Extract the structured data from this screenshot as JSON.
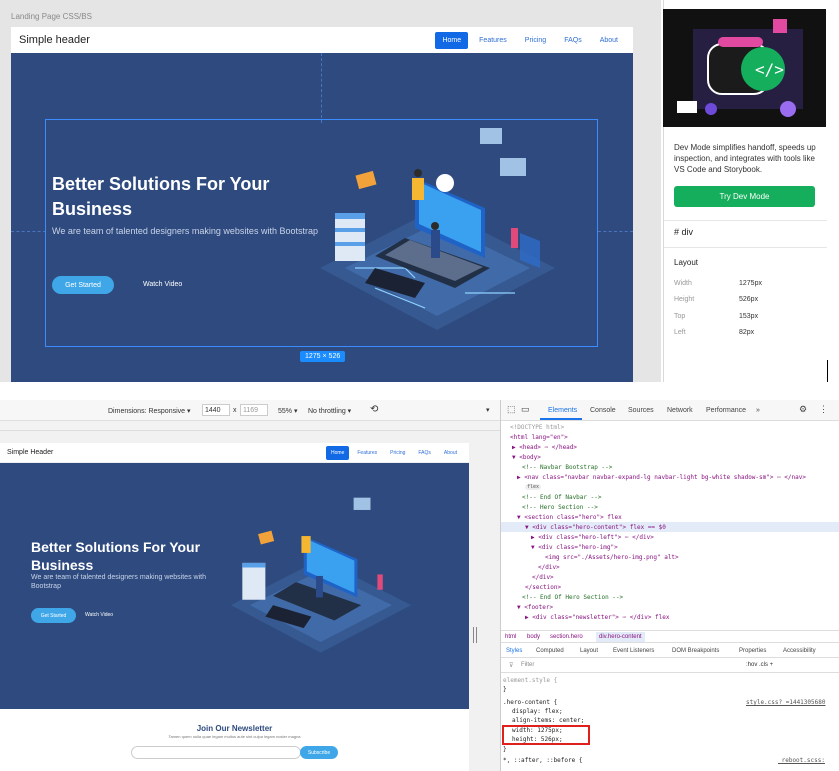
{
  "frame": {
    "label": "Landing Page CSS/BS",
    "size_badge": "1275 × 526",
    "nav": {
      "brand": "Simple header",
      "links": [
        "Home",
        "Features",
        "Pricing",
        "FAQs",
        "About"
      ]
    },
    "hero": {
      "title": "Better Solutions For Your Business",
      "subtitle": "We are team of talented designers making websites with Bootstrap",
      "cta": "Get Started",
      "watch": "Watch Video"
    }
  },
  "dev_panel": {
    "description": "Dev Mode simplifies handoff, speeds up inspection, and integrates with tools like VS Code and Storybook.",
    "try_button": "Try Dev Mode",
    "element_type": "div",
    "layout_heading": "Layout",
    "layout": [
      {
        "label": "Width",
        "value": "1275px"
      },
      {
        "label": "Height",
        "value": "526px"
      },
      {
        "label": "Top",
        "value": "153px"
      },
      {
        "label": "Left",
        "value": "82px"
      }
    ]
  },
  "devtools": {
    "toolbar": {
      "dimensions": "Dimensions: Responsive ▾",
      "width": "1440",
      "x": "x",
      "height": "1169",
      "zoom": "55% ▾",
      "throttle": "No throttling ▾"
    },
    "page": {
      "brand": "Simple Header",
      "links": [
        "Home",
        "Features",
        "Pricing",
        "FAQs",
        "About"
      ],
      "title": "Better Solutions For Your Business",
      "subtitle": "We are team of talented designers making websites with Bootstrap",
      "cta": "Get Started",
      "watch": "Watch Video",
      "newsletter_title": "Join Our Newsletter",
      "newsletter_sub": "Tamen quem nulla quae legam multos aute sint culpa legam noster magna",
      "subscribe": "Subscribe"
    },
    "tabs": [
      "Elements",
      "Console",
      "Sources",
      "Network",
      "Performance",
      "»"
    ],
    "dom": [
      "<!DOCTYPE html>",
      "<html lang=\"en\">",
      "▶ <head> ⋯ </head>",
      "▼ <body>",
      "<!-- Navbar Bootstrap -->",
      "▶ <nav class=\"navbar navbar-expand-lg navbar-light bg-white shadow-sm\"> ⋯ </nav>",
      "flex",
      "<!-- End Of Navbar -->",
      "<!-- Hero Section -->",
      "▼ <section class=\"hero\"> flex",
      "▼ <div class=\"hero-content\"> flex == $0",
      "▶ <div class=\"hero-left\"> ⋯ </div>",
      "▼ <div class=\"hero-img\">",
      "<img src=\"./Assets/hero-img.png\" alt>",
      "</div>",
      "</div>",
      "</section>",
      "<!-- End Of Hero Section -->",
      "▼ <footer>",
      "▶ <div class=\"newsletter\"> ⋯ </div> flex"
    ],
    "breadcrumbs": [
      "html",
      "body",
      "section.hero",
      "div.hero-content"
    ],
    "style_tabs": [
      "Styles",
      "Computed",
      "Layout",
      "Event Listeners",
      "DOM Breakpoints",
      "Properties",
      "Accessibility"
    ],
    "filter_placeholder": "Filter",
    "filter_tools": ":hov  .cls  +",
    "styles": {
      "element_style": "element.style {",
      "close1": "}",
      "selector": ".hero-content {",
      "source": "style.css?_=1441305680",
      "display": "display: flex;",
      "align": "align-items: center;",
      "width": "width: 1275px;",
      "height": "height: 526px;",
      "close2": "}",
      "universal": "*, ::after, ::before {",
      "source2": "_reboot.scss:"
    }
  }
}
